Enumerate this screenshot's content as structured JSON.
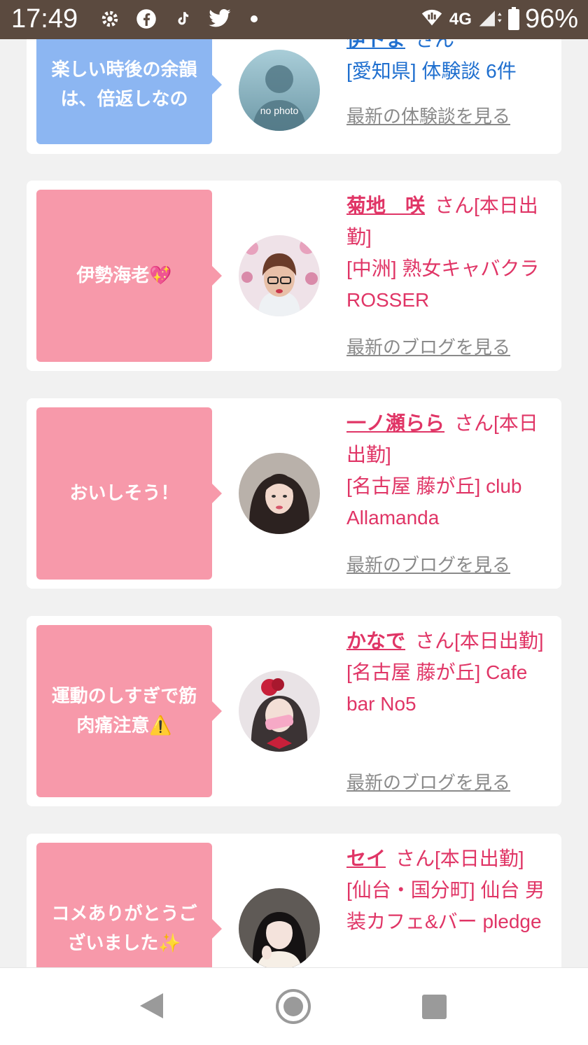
{
  "status_bar": {
    "time": "17:49",
    "network": "4G",
    "battery": "96%"
  },
  "posts": [
    {
      "comment": "楽しい時後の余韻は、倍返しなの",
      "color": "#8cb6f2",
      "avatar_label": "no photo",
      "name": "伊トま",
      "honorific": "さん",
      "detail": "[愛知県] 体験談 6件",
      "link": "最新の体験談を見る"
    },
    {
      "comment": "伊勢海老💖",
      "color": "#f799aa",
      "name": "菊地　咲",
      "honorific": "さん[本日出勤]",
      "detail": "[中洲] 熟女キャバクラ ROSSER",
      "link": "最新のブログを見る"
    },
    {
      "comment": "おいしそう！",
      "color": "#f799aa",
      "name": "一ノ瀬らら",
      "honorific": "さん[本日出勤]",
      "detail": "[名古屋 藤が丘] club Allamanda",
      "link": "最新のブログを見る"
    },
    {
      "comment": "運動のしすぎで筋肉痛注意⚠️",
      "color": "#f799aa",
      "name": "かなで",
      "honorific": "さん[本日出勤]",
      "detail": "[名古屋 藤が丘] Cafe bar No5",
      "link": "最新のブログを見る"
    },
    {
      "comment": "コメありがとうございました✨",
      "color": "#f799aa",
      "name": "セイ",
      "honorific": "さん[本日出勤]",
      "detail": "[仙台・国分町] 仙台 男装カフェ&バー pledge",
      "link": ""
    }
  ]
}
